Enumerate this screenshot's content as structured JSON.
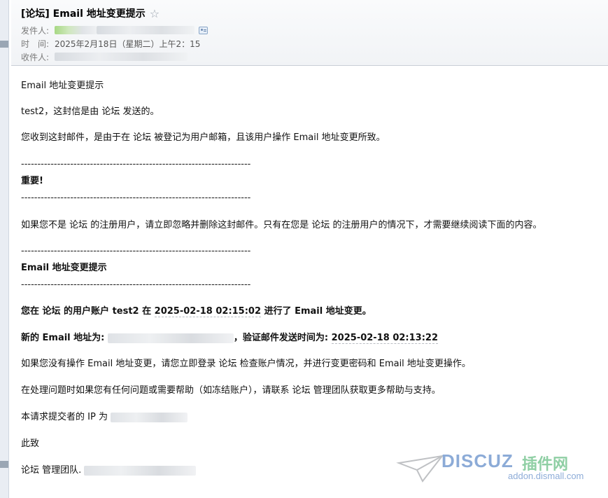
{
  "header": {
    "subject": "[论坛] Email 地址变更提示",
    "from_label": "发件人:",
    "time_label": "时　间:",
    "time_value": "2025年2月18日（星期二）上午2：15",
    "to_label": "收件人:"
  },
  "body": {
    "heading": "Email 地址变更提示",
    "greeting": "test2，这封信是由 论坛 发送的。",
    "reason": "您收到这封邮件，是由于在 论坛 被登记为用户邮箱，且该用户操作 Email 地址变更所致。",
    "divider": "----------------------------------------------------------------------",
    "important": "重要!",
    "warning": "如果您不是 论坛 的注册用户，请立即忽略并删除这封邮件。只有在您是 论坛 的注册用户的情况下，才需要继续阅读下面的内容。",
    "section_title": "Email 地址变更提示",
    "change_line_prefix": "您在 论坛 的用户账户 test2 在 ",
    "change_time": "2025-02-18 02:15:02",
    "change_line_suffix": " 进行了 Email 地址变更。",
    "new_email_label": "新的 Email 地址为:",
    "verify_label": "，验证邮件发送时间为: ",
    "verify_time": "2025-02-18 02:13:22",
    "not_you": "如果您没有操作 Email 地址变更，请您立即登录 论坛 检查账户情况，并进行变更密码和 Email 地址变更操作。",
    "help": "在处理问题时如果您有任何问题或需要帮助（如冻结账户），请联系 论坛 管理团队获取更多帮助与支持。",
    "ip_label": "本请求提交者的 IP 为",
    "closing": "此致",
    "signature": "论坛 管理团队."
  },
  "watermark": {
    "brand_text": "DISCUZ",
    "cn_text": "插件网",
    "url": "addon.dismall.com"
  },
  "icons": {
    "star": "star-icon",
    "contact_card": "contact-card-icon"
  },
  "colors": {
    "accent_blue": "#2f67b8",
    "accent_green": "#34a85a"
  }
}
